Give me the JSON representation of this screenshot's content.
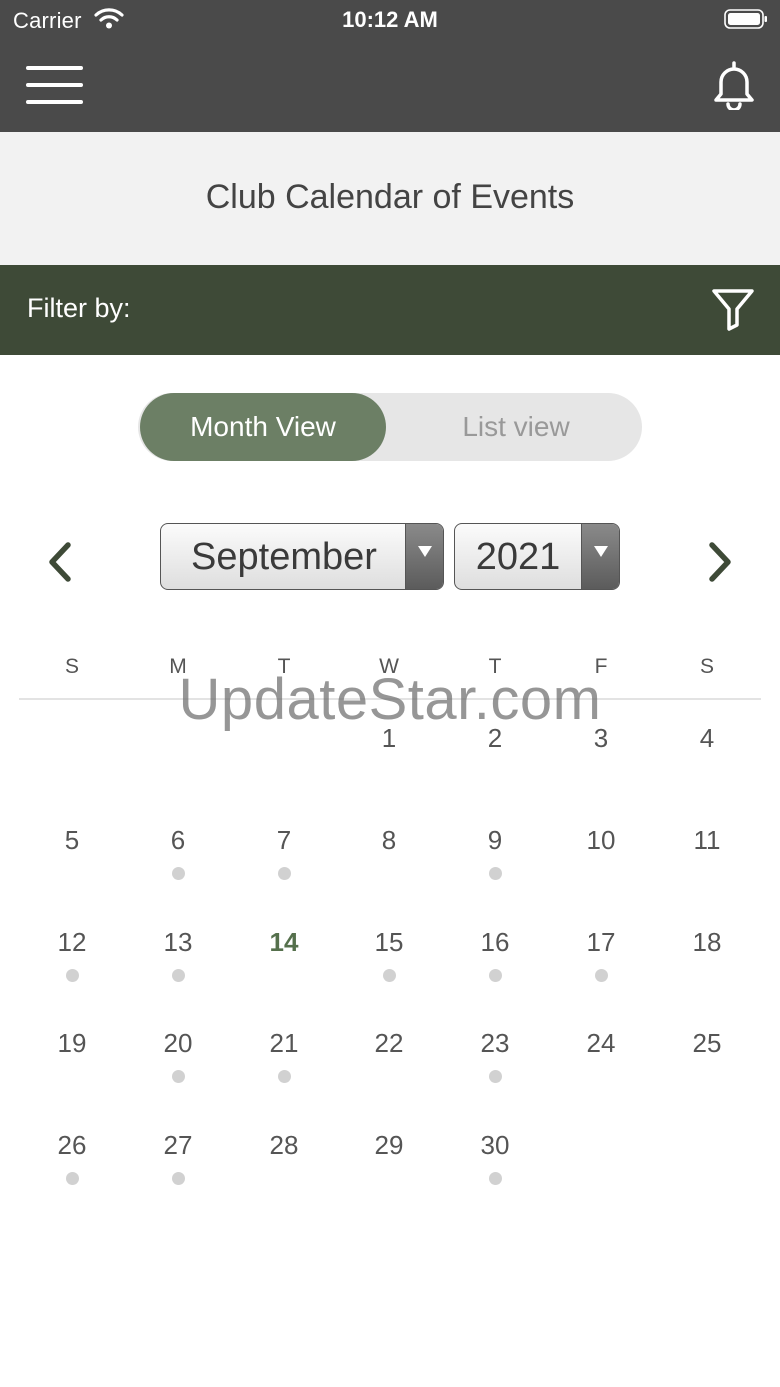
{
  "status_bar": {
    "carrier": "Carrier",
    "time": "10:12 AM"
  },
  "nav": {
    "menu_icon": "hamburger-menu-icon",
    "bell_icon": "bell-icon"
  },
  "page": {
    "title": "Club Calendar of Events"
  },
  "filter": {
    "label": "Filter by:",
    "icon": "filter-funnel-icon"
  },
  "view_toggle": {
    "month": "Month View",
    "list": "List view",
    "selected": "month"
  },
  "picker": {
    "month": "September",
    "year": "2021"
  },
  "weekdays": [
    "S",
    "M",
    "T",
    "W",
    "T",
    "F",
    "S"
  ],
  "calendar": {
    "today": 14,
    "weeks": [
      [
        null,
        null,
        null,
        {
          "n": "1",
          "dot": false
        },
        {
          "n": "2",
          "dot": false
        },
        {
          "n": "3",
          "dot": false
        },
        {
          "n": "4",
          "dot": false
        }
      ],
      [
        {
          "n": "5",
          "dot": false
        },
        {
          "n": "6",
          "dot": true
        },
        {
          "n": "7",
          "dot": true
        },
        {
          "n": "8",
          "dot": false
        },
        {
          "n": "9",
          "dot": true
        },
        {
          "n": "10",
          "dot": false
        },
        {
          "n": "11",
          "dot": false
        }
      ],
      [
        {
          "n": "12",
          "dot": true
        },
        {
          "n": "13",
          "dot": true
        },
        {
          "n": "14",
          "dot": false
        },
        {
          "n": "15",
          "dot": true
        },
        {
          "n": "16",
          "dot": true
        },
        {
          "n": "17",
          "dot": true
        },
        {
          "n": "18",
          "dot": false
        }
      ],
      [
        {
          "n": "19",
          "dot": false
        },
        {
          "n": "20",
          "dot": true
        },
        {
          "n": "21",
          "dot": true
        },
        {
          "n": "22",
          "dot": false
        },
        {
          "n": "23",
          "dot": true
        },
        {
          "n": "24",
          "dot": false
        },
        {
          "n": "25",
          "dot": false
        }
      ],
      [
        {
          "n": "26",
          "dot": true
        },
        {
          "n": "27",
          "dot": true
        },
        {
          "n": "28",
          "dot": false
        },
        {
          "n": "29",
          "dot": false
        },
        {
          "n": "30",
          "dot": true
        },
        null,
        null
      ]
    ]
  },
  "watermark": "UpdateStar.com",
  "colors": {
    "topbar": "#4a4a4a",
    "filterbar": "#3e4a37",
    "accent": "#6c7f65",
    "today": "#55704c",
    "dot": "#d1d1d1"
  }
}
